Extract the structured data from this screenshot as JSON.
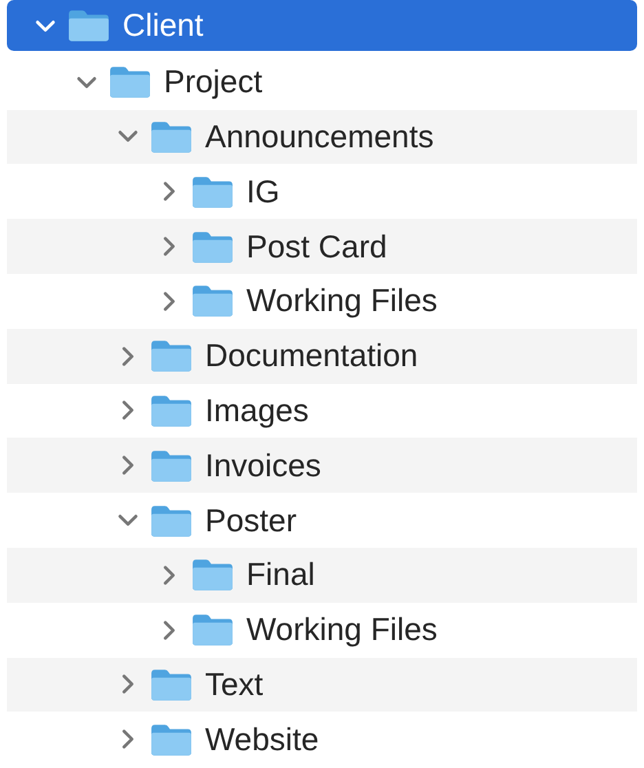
{
  "tree": [
    {
      "label": "Client",
      "expanded": true,
      "selected": true,
      "children": [
        {
          "label": "Project",
          "expanded": true,
          "selected": false,
          "children": [
            {
              "label": "Announcements",
              "expanded": true,
              "selected": false,
              "children": [
                {
                  "label": "IG",
                  "expanded": false,
                  "selected": false
                },
                {
                  "label": "Post Card",
                  "expanded": false,
                  "selected": false
                },
                {
                  "label": "Working Files",
                  "expanded": false,
                  "selected": false
                }
              ]
            },
            {
              "label": "Documentation",
              "expanded": false,
              "selected": false
            },
            {
              "label": "Images",
              "expanded": false,
              "selected": false
            },
            {
              "label": "Invoices",
              "expanded": false,
              "selected": false
            },
            {
              "label": "Poster",
              "expanded": true,
              "selected": false,
              "children": [
                {
                  "label": "Final",
                  "expanded": false,
                  "selected": false
                },
                {
                  "label": "Working Files",
                  "expanded": false,
                  "selected": false
                }
              ]
            },
            {
              "label": "Text",
              "expanded": false,
              "selected": false
            },
            {
              "label": "Website",
              "expanded": false,
              "selected": false
            }
          ]
        }
      ]
    }
  ]
}
